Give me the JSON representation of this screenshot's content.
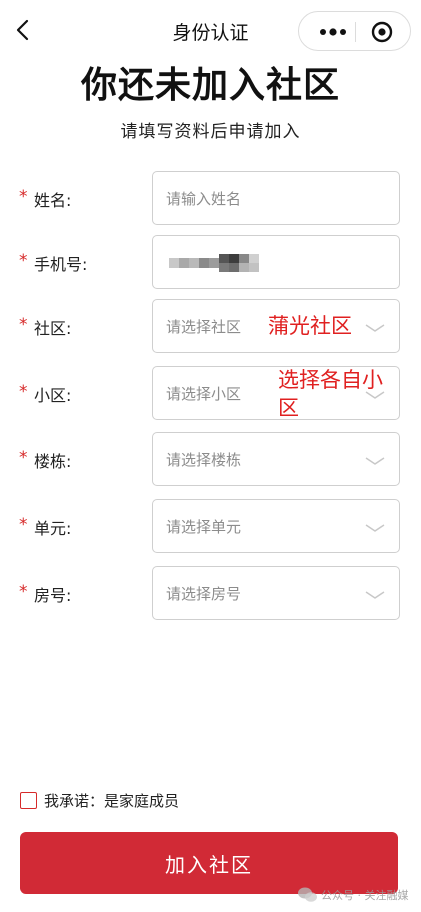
{
  "nav": {
    "title": "身份认证"
  },
  "header": {
    "headline": "你还未加入社区",
    "subline": "请填写资料后申请加入"
  },
  "form": {
    "required_mark": "*",
    "fields": [
      {
        "label": "姓名:",
        "placeholder": "请输入姓名",
        "kind": "input"
      },
      {
        "label": "手机号:",
        "placeholder": "",
        "kind": "masked"
      },
      {
        "label": "社区:",
        "placeholder": "请选择社区",
        "kind": "select"
      },
      {
        "label": "小区:",
        "placeholder": "请选择小区",
        "kind": "select"
      },
      {
        "label": "楼栋:",
        "placeholder": "请选择楼栋",
        "kind": "select"
      },
      {
        "label": "单元:",
        "placeholder": "请选择单元",
        "kind": "select"
      },
      {
        "label": "房号:",
        "placeholder": "请选择房号",
        "kind": "select"
      }
    ]
  },
  "annotations": {
    "community": "蒲光社区",
    "estate": "选择各自小区"
  },
  "agreement": {
    "text": "我承诺：是家庭成员"
  },
  "submit": {
    "label": "加入社区"
  },
  "watermark": {
    "text": "公众号 · 关注融媒"
  },
  "colors": {
    "accent": "#d12a36",
    "required": "#d62a2a",
    "annotation": "#e02020"
  }
}
